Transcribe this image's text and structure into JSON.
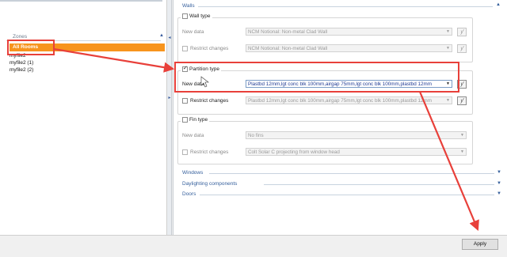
{
  "zones": {
    "header": "Zones",
    "selected": "All Rooms",
    "items": [
      "myfile2",
      "myfile2 (1)",
      "myfile2 (2)"
    ]
  },
  "sections": {
    "walls": "Walls",
    "windows": "Windows",
    "daylighting": "Daylighting components",
    "doors": "Doors"
  },
  "wall_type": {
    "title": "Wall type",
    "new_data_label": "New data",
    "new_data_value": "NCM Notional: Non-metal Clad Wall",
    "restrict_label": "Restrict changes",
    "restrict_value": "NCM Notional: Non-metal Clad Wall"
  },
  "partition_type": {
    "title": "Partition type",
    "new_data_label": "New data",
    "new_data_value": "Plastbd 12mm,lgt conc blk 100mm,airgap 75mm,lgt conc blk 100mm,plastbd 12mm",
    "restrict_label": "Restrict changes",
    "restrict_value": "Plastbd 12mm,lgt conc blk 100mm,airgap 75mm,lgt conc blk 100mm,plastbd 12mm"
  },
  "fin_type": {
    "title": "Fin type",
    "new_data_label": "New data",
    "new_data_value": "No fins",
    "restrict_label": "Restrict changes",
    "restrict_value": "Colt Solar C projecting from window head"
  },
  "icons": {
    "yes_btn": "ƴ"
  },
  "apply_label": "Apply",
  "colors": {
    "selection": "#f7941d",
    "annotation": "#e8403a",
    "section_text": "#355f9c"
  }
}
